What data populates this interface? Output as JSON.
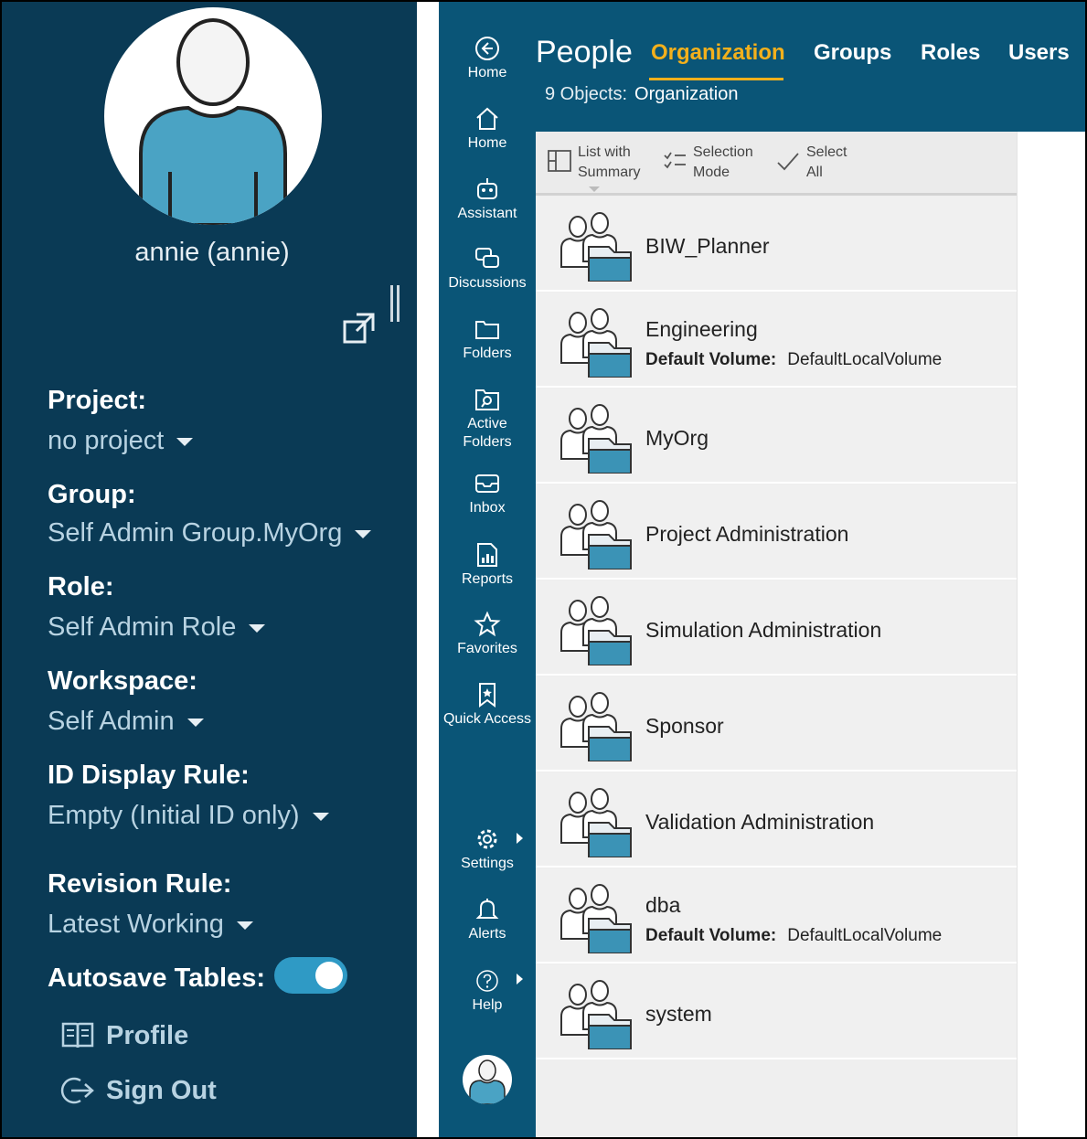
{
  "user_panel": {
    "username": "annie (annie)",
    "fields": [
      {
        "label": "Project:",
        "value": "no project"
      },
      {
        "label": "Group:",
        "value": "Self Admin Group.MyOrg"
      },
      {
        "label": "Role:",
        "value": "Self Admin Role"
      },
      {
        "label": "Workspace:",
        "value": "Self Admin"
      },
      {
        "label": "ID Display Rule:",
        "value": "Empty (Initial ID only)"
      },
      {
        "label": "Revision Rule:",
        "value": "Latest Working"
      }
    ],
    "autosave_label": "Autosave Tables:",
    "autosave_on": true,
    "profile_label": "Profile",
    "signout_label": "Sign Out"
  },
  "nav": {
    "items": [
      {
        "label": "Home",
        "icon": "back-circle-icon"
      },
      {
        "label": "Home",
        "icon": "house-icon"
      },
      {
        "label": "Assistant",
        "icon": "robot-icon"
      },
      {
        "label": "Discussions",
        "icon": "chat-bubbles-icon"
      },
      {
        "label": "Folders",
        "icon": "folder-icon"
      },
      {
        "label": "Active",
        "label2": "Folders",
        "icon": "active-folder-icon"
      },
      {
        "label": "Inbox",
        "icon": "inbox-icon"
      },
      {
        "label": "Reports",
        "icon": "report-icon"
      },
      {
        "label": "Favorites",
        "icon": "star-icon"
      },
      {
        "label": "Quick Access",
        "icon": "bookmark-icon"
      },
      {
        "label": "Settings",
        "icon": "gear-icon"
      },
      {
        "label": "Alerts",
        "icon": "bell-icon"
      },
      {
        "label": "Help",
        "icon": "help-icon"
      }
    ]
  },
  "header": {
    "title": "People",
    "tabs": [
      "Organization",
      "Groups",
      "Roles",
      "Users"
    ],
    "active_tab": "Organization",
    "count_label": "9 Objects:",
    "count_value": "Organization"
  },
  "toolbar": {
    "view_line1": "List with",
    "view_line2": "Summary",
    "selection_line1": "Selection",
    "selection_line2": "Mode",
    "select_all_line1": "Select",
    "select_all_line2": "All"
  },
  "rows": [
    {
      "name": "BIW_Planner",
      "sub_label": "",
      "sub_value": ""
    },
    {
      "name": "Engineering",
      "sub_label": "Default Volume:",
      "sub_value": "DefaultLocalVolume"
    },
    {
      "name": "MyOrg",
      "sub_label": "",
      "sub_value": ""
    },
    {
      "name": "Project Administration",
      "sub_label": "",
      "sub_value": ""
    },
    {
      "name": "Simulation Administration",
      "sub_label": "",
      "sub_value": ""
    },
    {
      "name": "Sponsor",
      "sub_label": "",
      "sub_value": ""
    },
    {
      "name": "Validation Administration",
      "sub_label": "",
      "sub_value": ""
    },
    {
      "name": "dba",
      "sub_label": "Default Volume:",
      "sub_value": "DefaultLocalVolume"
    },
    {
      "name": "system",
      "sub_label": "",
      "sub_value": ""
    }
  ],
  "colors": {
    "panel_bg": "#0a3a55",
    "nav_bg": "#0a5577",
    "accent": "#f3b01c",
    "toggle": "#2f9ac5"
  }
}
